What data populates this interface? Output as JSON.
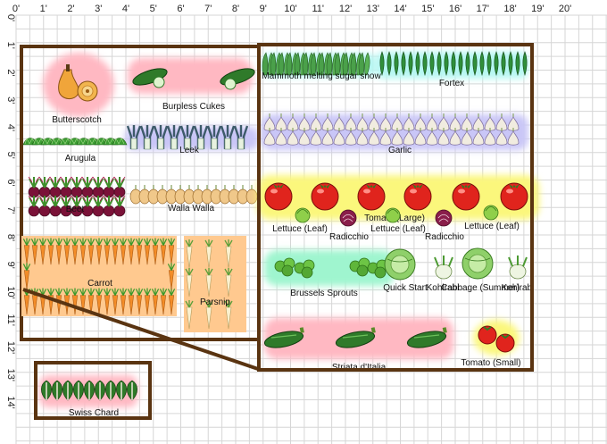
{
  "rulers": {
    "top": [
      "0'",
      "1'",
      "2'",
      "3'",
      "4'",
      "5'",
      "6'",
      "7'",
      "8'",
      "9'",
      "10'",
      "11'",
      "12'",
      "13'",
      "14'",
      "15'",
      "16'",
      "17'",
      "18'",
      "19'",
      "20'"
    ],
    "left": [
      "0'",
      "1'",
      "2'",
      "3'",
      "4'",
      "5'",
      "6'",
      "7'",
      "8'",
      "9'",
      "10'",
      "11'",
      "12'",
      "13'",
      "14'"
    ]
  },
  "beds": {
    "left": {
      "butterscotch": "Butterscotch",
      "burpless_cukes": "Burpless Cukes",
      "arugula": "Arugula",
      "leek": "Leek",
      "beet": "Beet",
      "walla_walla": "Walla Walla",
      "carrot": "Carrot",
      "parsnip": "Parsnip"
    },
    "right": {
      "mammoth_sugar_snow": "Mammoth melting sugar snow",
      "fortex": "Fortex",
      "garlic": "Garlic",
      "tomato_large": "Tomato (Large)",
      "lettuce_1": "Lettuce (Leaf)",
      "radicchio_1": "Radicchio",
      "lettuce_2": "Lettuce (Leaf)",
      "radicchio_2": "Radicchio",
      "lettuce_3": "Lettuce (Leaf)",
      "brussels_sprouts": "Brussels Sprouts",
      "quick_start": "Quick Start",
      "kohlrabi_1": "Kohlrabi",
      "cabbage_summer": "Cabbage (Summer)",
      "kohlrabi_2": "Kohlrabi",
      "striata": "Striata d'Italia",
      "tomato_small": "Tomato (Small)"
    },
    "small": {
      "swiss_chard": "Swiss Chard"
    }
  },
  "colors": {
    "bed_border": "#5a3411",
    "grid": "#d6d6d6",
    "highlight_red": "#ffb8c2",
    "highlight_green": "#9ff5cf",
    "highlight_purple": "#c9c6f7",
    "highlight_yellow": "#fbf77c",
    "highlight_orange": "#ffc98f",
    "highlight_teal": "#b5f7f2"
  }
}
